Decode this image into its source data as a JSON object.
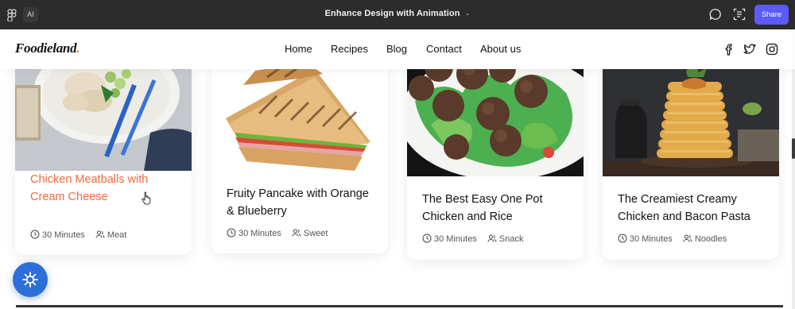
{
  "topbar": {
    "ai_label": "AI",
    "title": "Enhance Design with Animation",
    "title_chevron": "⌄",
    "share_label": "Share",
    "colors": {
      "bar": "#2c2c2c",
      "share": "#5b5bf6"
    }
  },
  "site": {
    "brand": "Foodieland",
    "brand_dot": ".",
    "nav": [
      "Home",
      "Recipes",
      "Blog",
      "Contact",
      "About us"
    ],
    "social": [
      "facebook-icon",
      "twitter-icon",
      "instagram-icon"
    ],
    "accent": "#ef6a3c"
  },
  "cards": [
    {
      "title": "Chicken Meatballs with Cream Cheese",
      "time": "30 Minutes",
      "category": "Meat",
      "hovered": true
    },
    {
      "title": "Fruity Pancake with Orange & Blueberry",
      "time": "30 Minutes",
      "category": "Sweet",
      "hovered": false
    },
    {
      "title": "The Best Easy One Pot Chicken and Rice",
      "time": "30 Minutes",
      "category": "Snack",
      "hovered": false
    },
    {
      "title": "The Creamiest Creamy Chicken and Bacon Pasta",
      "time": "30 Minutes",
      "category": "Noodles",
      "hovered": false
    }
  ]
}
